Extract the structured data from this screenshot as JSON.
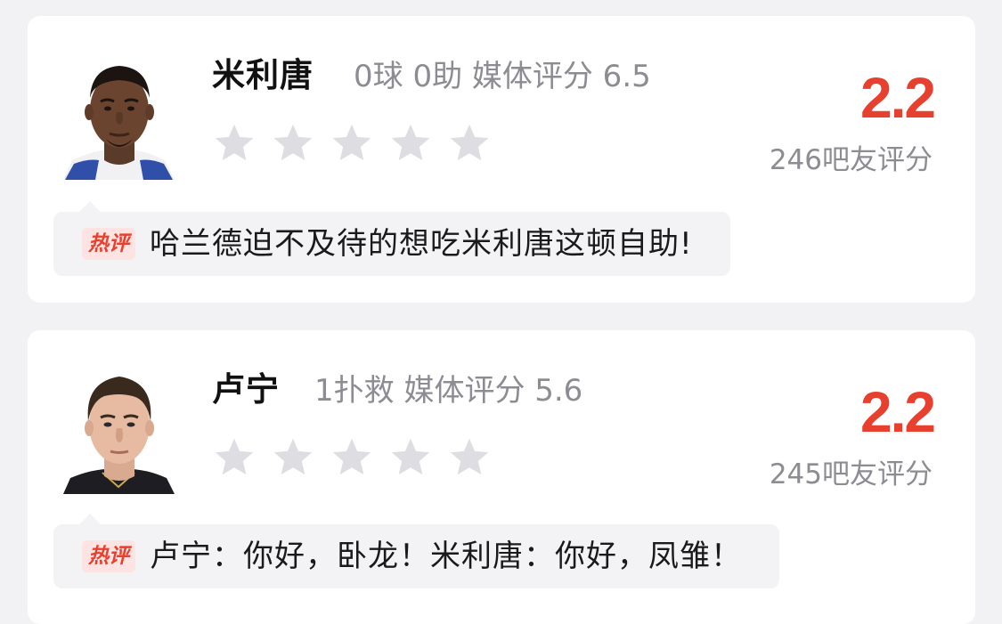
{
  "players": [
    {
      "name": "米利唐",
      "stats": "0球 0助  媒体评分 6.5",
      "score": "2.2",
      "votes": "246吧友评分",
      "stars_filled": 0,
      "stars_total": 5,
      "comment_tag": "热评",
      "comment": "哈兰德迫不及待的想吃米利唐这顿自助!"
    },
    {
      "name": "卢宁",
      "stats": "1扑救  媒体评分 5.6",
      "score": "2.2",
      "votes": "245吧友评分",
      "stars_filled": 0,
      "stars_total": 5,
      "comment_tag": "热评",
      "comment": "卢宁：你好，卧龙！米利唐：你好，凤雏！"
    }
  ],
  "colors": {
    "score": "#e8402e",
    "star_empty": "#dddde2",
    "muted_text": "#8c8c93",
    "tag_bg": "#fde4e2",
    "bubble_bg": "#f3f3f6"
  }
}
